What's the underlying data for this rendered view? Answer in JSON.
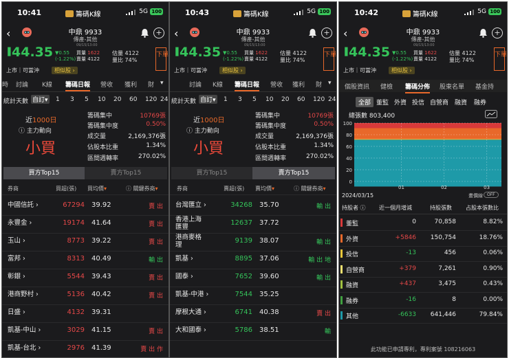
{
  "common": {
    "app_title": "籌碼K線",
    "net": "5G",
    "battery": "100",
    "stock_name": "中鼎 9933",
    "stock_sub": "傳產-其他",
    "price": "44.35",
    "change": "▼0.55",
    "change_pct": "(-1.22%)",
    "tiny_time": "09/15/13:00",
    "buy_label": "買量",
    "buy_val": "1622",
    "sell_label": "賣量",
    "sell_val": "4122",
    "est_label": "估量",
    "est_val": "4122",
    "ratio_label": "量比",
    "ratio_val": "74%",
    "sell_btn": "下單",
    "tag_listed": "上市｜可當沖",
    "tag_similar": "相似股 ›",
    "colors": {
      "green": "#35c35a",
      "red": "#e64848",
      "accent": "#e8682a"
    }
  },
  "p1": {
    "time": "10:41",
    "tabs": [
      "時",
      "討論",
      "K線",
      "籌碼日報",
      "營收",
      "獲利",
      "財"
    ],
    "active_tab": "籌碼日報",
    "days_label": "統計天數",
    "custom": "自訂",
    "days": [
      "1",
      "3",
      "5",
      "10",
      "20",
      "60",
      "120",
      "24"
    ]
  },
  "p2": {
    "time": "10:43",
    "tabs": [
      "討論",
      "K線",
      "籌碼日報",
      "營收",
      "獲利",
      "財"
    ],
    "active_tab": "籌碼日報",
    "days_label": "統計天數",
    "custom": "自訂",
    "days": [
      "1",
      "3",
      "5",
      "10",
      "20",
      "60",
      "120",
      "24"
    ]
  },
  "summary": {
    "near_prefix": "近",
    "near_days": "1000日",
    "force": "ⓘ 主力動向",
    "verdict": "小買",
    "stats": [
      {
        "k": "籌碼集中",
        "v": "10769張",
        "c": "red"
      },
      {
        "k": "籌碼集中度",
        "v": "0.50%",
        "c": "red"
      },
      {
        "k": "成交量",
        "v": "2,169,376張",
        "c": "white"
      },
      {
        "k": "佔股本比重",
        "v": "1.34%",
        "c": "white"
      },
      {
        "k": "區間週轉率",
        "v": "270.02%",
        "c": "white"
      }
    ],
    "seg_buy": "買方Top15",
    "seg_sell": "賣方Top15"
  },
  "table1": {
    "headers": [
      "券商",
      "買超(張)",
      "買均價",
      "ⓘ 關鍵券商"
    ],
    "rows": [
      {
        "broker": "中國信託 ›",
        "qty": "67294",
        "avg": "39.92",
        "key": "賣 出",
        "kc": "red"
      },
      {
        "broker": "永豐金 ›",
        "qty": "19174",
        "avg": "41.64",
        "key": "賣 出",
        "kc": "red"
      },
      {
        "broker": "玉山 ›",
        "qty": "8773",
        "avg": "39.22",
        "key": "賣 出",
        "kc": "red"
      },
      {
        "broker": "富邦 ›",
        "qty": "8313",
        "avg": "40.49",
        "key": "輸 出",
        "kc": "green"
      },
      {
        "broker": "彰銀 ›",
        "qty": "5544",
        "avg": "39.43",
        "key": "賣 出",
        "kc": "red"
      },
      {
        "broker": "港商野村 ›",
        "qty": "5136",
        "avg": "40.42",
        "key": "賣 出",
        "kc": "red"
      },
      {
        "broker": "日盛 ›",
        "qty": "4132",
        "avg": "39.31",
        "key": "",
        "kc": "red"
      },
      {
        "broker": "凱基-中山 ›",
        "qty": "3029",
        "avg": "41.15",
        "key": "賣 出",
        "kc": "red"
      },
      {
        "broker": "凱基-台北 ›",
        "qty": "2976",
        "avg": "41.39",
        "key": "賣 出 作",
        "kc": "red"
      }
    ]
  },
  "table2": {
    "headers": [
      "券商",
      "賣超(張)",
      "賣均價",
      "ⓘ 關鍵券商"
    ],
    "rows": [
      {
        "broker": "台灣匯立 ›",
        "qty": "34268",
        "avg": "35.70",
        "key": "輸 出",
        "kc": "green"
      },
      {
        "broker": "香港上海\n匯豐",
        "qty": "12637",
        "avg": "37.72",
        "key": "",
        "kc": "green"
      },
      {
        "broker": "港商麥格\n理",
        "qty": "9139",
        "avg": "38.07",
        "key": "輸 出",
        "kc": "green"
      },
      {
        "broker": "凱基 ›",
        "qty": "8895",
        "avg": "37.06",
        "key": "輸 出 地",
        "kc": "green"
      },
      {
        "broker": "國泰 ›",
        "qty": "7652",
        "avg": "39.60",
        "key": "輸 出",
        "kc": "green"
      },
      {
        "broker": "凱基-中港 ›",
        "qty": "7544",
        "avg": "35.25",
        "key": "",
        "kc": "green"
      },
      {
        "broker": "摩根大通 ›",
        "qty": "6741",
        "avg": "40.38",
        "key": "賣 出",
        "kc": "red"
      },
      {
        "broker": "大和國泰 ›",
        "qty": "5786",
        "avg": "38.51",
        "key": "輸",
        "kc": "green"
      }
    ]
  },
  "p3": {
    "time": "10:42",
    "tabs": [
      "個股資訊",
      "健檢",
      "籌碼分佈",
      "股東名單",
      "基金持"
    ],
    "active_tab": "籌碼分佈",
    "subtabs": [
      "全部",
      "董監",
      "外資",
      "投信",
      "自營商",
      "融資",
      "融券"
    ],
    "active_sub": "全部",
    "total": "總張數 803,400",
    "yticks": [
      "100",
      "80",
      "60",
      "40",
      "20",
      "0"
    ],
    "xticks": [
      "01",
      "02",
      "03"
    ],
    "date": "2024/03/15",
    "toggle": "畫價線",
    "toggle_state": "OFF",
    "headers": [
      "持股者 ⓘ",
      "近一個月增減",
      "持股張數",
      "占股本張數比"
    ],
    "holders": [
      {
        "name": "董監",
        "delta": "0",
        "dc": "white",
        "qty": "70,858",
        "pct": "8.82%",
        "color": "#d83a3a"
      },
      {
        "name": "外資",
        "delta": "+5846",
        "dc": "red",
        "qty": "150,754",
        "pct": "18.76%",
        "color": "#e8682a"
      },
      {
        "name": "投信",
        "delta": "-13",
        "dc": "green",
        "qty": "456",
        "pct": "0.06%",
        "color": "#e8c63a"
      },
      {
        "name": "自營商",
        "delta": "+379",
        "dc": "red",
        "qty": "7,261",
        "pct": "0.90%",
        "color": "#f0e070"
      },
      {
        "name": "融資",
        "delta": "+437",
        "dc": "red",
        "qty": "3,475",
        "pct": "0.43%",
        "color": "#a0c040"
      },
      {
        "name": "融券",
        "delta": "-16",
        "dc": "green",
        "qty": "8",
        "pct": "0.00%",
        "color": "#40a040"
      },
      {
        "name": "其他",
        "delta": "-6633",
        "dc": "green",
        "qty": "641,446",
        "pct": "79.84%",
        "color": "#1e9aa8"
      }
    ],
    "footer": "此功能已申請專利，專利案號 108216063"
  }
}
